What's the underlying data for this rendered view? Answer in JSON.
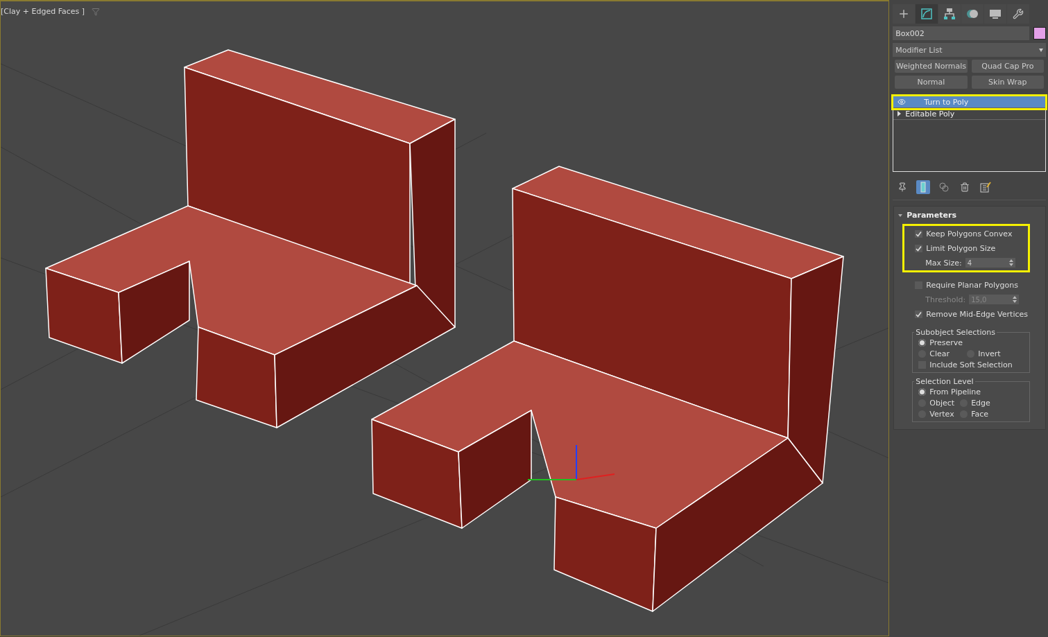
{
  "viewport": {
    "label": "[Clay + Edged Faces ]",
    "filter_on": false
  },
  "command_tabs": [
    {
      "kind": "create",
      "selected": false
    },
    {
      "kind": "modify",
      "selected": true
    },
    {
      "kind": "hierarchy",
      "selected": false
    },
    {
      "kind": "motion",
      "selected": false
    },
    {
      "kind": "display",
      "selected": false
    },
    {
      "kind": "utilities",
      "selected": false
    }
  ],
  "object": {
    "name": "Box002",
    "color": "#e4a0e8"
  },
  "modifier_list": {
    "label": "Modifier List"
  },
  "modifier_buttons": [
    "Weighted Normals",
    "Quad Cap Pro",
    "Normal",
    "Skin Wrap"
  ],
  "stack": [
    {
      "label": "Turn to Poly",
      "selected": true,
      "highlighted": true,
      "kind": "modifier"
    },
    {
      "label": "Editable Poly",
      "selected": false,
      "highlighted": false,
      "kind": "base"
    }
  ],
  "stack_tools": [
    {
      "kind": "pin",
      "on": false
    },
    {
      "kind": "show-end-result",
      "on": true
    },
    {
      "kind": "make-unique",
      "on": false
    },
    {
      "kind": "remove",
      "on": false
    },
    {
      "kind": "configure",
      "on": false
    }
  ],
  "parameters": {
    "title": "Parameters",
    "expanded": true,
    "items": [
      {
        "kind": "checkbox",
        "label": "Keep Polygons Convex",
        "checked": true,
        "highlighted": true
      },
      {
        "kind": "checkbox",
        "label": "Limit Polygon Size",
        "checked": true,
        "highlighted": true
      },
      {
        "kind": "spinner",
        "label": "Max Size:",
        "value": "4",
        "disabled": false,
        "highlighted": true
      },
      {
        "kind": "checkbox",
        "label": "Require Planar Polygons",
        "checked": false,
        "highlighted": false
      },
      {
        "kind": "spinner",
        "label": "Threshold:",
        "value": "15,0",
        "disabled": true,
        "highlighted": false
      },
      {
        "kind": "checkbox",
        "label": "Remove Mid-Edge Vertices",
        "checked": true,
        "highlighted": false
      }
    ]
  },
  "subobject_selections": {
    "title": "Subobject Selections",
    "options": [
      {
        "label": "Preserve",
        "selected": true
      },
      {
        "label": "Clear",
        "selected": false
      },
      {
        "label": "Invert",
        "selected": false
      }
    ],
    "include_soft_selection": {
      "label": "Include Soft Selection",
      "checked": false
    }
  },
  "selection_level": {
    "title": "Selection Level",
    "options": [
      {
        "label": "From Pipeline",
        "selected": true
      },
      {
        "label": "Object",
        "selected": false
      },
      {
        "label": "Edge",
        "selected": false
      },
      {
        "label": "Vertex",
        "selected": false
      },
      {
        "label": "Face",
        "selected": false
      }
    ]
  }
}
